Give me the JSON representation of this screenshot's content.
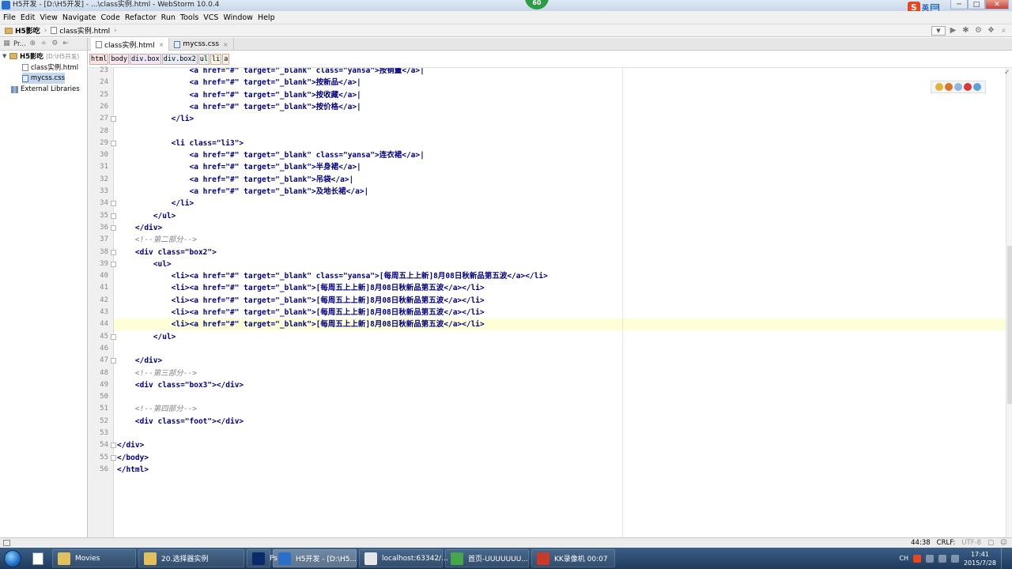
{
  "window": {
    "title": "H5开发 - [D:\\H5开发] - ...\\class实例.html - WebStorm 10.0.4",
    "badge": "60",
    "ime_lang": "英",
    "controls": {
      "minimize": "─",
      "maximize": "□",
      "close": "✕"
    }
  },
  "menu": [
    "File",
    "Edit",
    "View",
    "Navigate",
    "Code",
    "Refactor",
    "Run",
    "Tools",
    "VCS",
    "Window",
    "Help"
  ],
  "navbar": {
    "project": "H5影吃",
    "file": "class实例.html",
    "sep": "›"
  },
  "project_panel": {
    "toolbar_label": "Pr...",
    "root": {
      "name": "H5影吃",
      "path": "(D:\\H5开发)"
    },
    "files": [
      "class实例.html",
      "mycss.css"
    ],
    "external": "External Libraries"
  },
  "tabs": [
    {
      "label": "class实例.html",
      "active": true
    },
    {
      "label": "mycss.css",
      "active": false
    }
  ],
  "tag_breadcrumb": [
    "html",
    "body",
    "div.box",
    "div.box2",
    "ul",
    "li",
    "a"
  ],
  "code": {
    "lines": [
      {
        "n": "23",
        "text": "                <a href=\"#\" target=\"_blank\" class=\"yansa\">按销量</a>|",
        "kind": "tag"
      },
      {
        "n": "24",
        "text": "                <a href=\"#\" target=\"_blank\">按新品</a>|",
        "kind": "tag"
      },
      {
        "n": "25",
        "text": "                <a href=\"#\" target=\"_blank\">按收藏</a>|",
        "kind": "tag"
      },
      {
        "n": "26",
        "text": "                <a href=\"#\" target=\"_blank\">按价格</a>|",
        "kind": "tag"
      },
      {
        "n": "27",
        "text": "            </li>",
        "kind": "tag"
      },
      {
        "n": "28",
        "text": "",
        "kind": "tag"
      },
      {
        "n": "29",
        "text": "            <li class=\"li3\">",
        "kind": "tag"
      },
      {
        "n": "30",
        "text": "                <a href=\"#\" target=\"_blank\" class=\"yansa\">连衣裙</a>|",
        "kind": "tag"
      },
      {
        "n": "31",
        "text": "                <a href=\"#\" target=\"_blank\">半身裙</a>|",
        "kind": "tag"
      },
      {
        "n": "32",
        "text": "                <a href=\"#\" target=\"_blank\">吊袋</a>|",
        "kind": "tag"
      },
      {
        "n": "33",
        "text": "                <a href=\"#\" target=\"_blank\">及地长裙</a>|",
        "kind": "tag"
      },
      {
        "n": "34",
        "text": "            </li>",
        "kind": "tag"
      },
      {
        "n": "35",
        "text": "        </ul>",
        "kind": "tag"
      },
      {
        "n": "36",
        "text": "    </div>",
        "kind": "tag"
      },
      {
        "n": "37",
        "text": "    <!--第二部分-->",
        "kind": "comment"
      },
      {
        "n": "38",
        "text": "    <div class=\"box2\">",
        "kind": "tag"
      },
      {
        "n": "39",
        "text": "        <ul>",
        "kind": "tag"
      },
      {
        "n": "40",
        "text": "            <li><a href=\"#\" target=\"_blank\" class=\"yansa\">[每周五上上新]8月08日秋新品第五波</a></li>",
        "kind": "tag"
      },
      {
        "n": "41",
        "text": "            <li><a href=\"#\" target=\"_blank\">[每周五上上新]8月08日秋新品第五波</a></li>",
        "kind": "tag"
      },
      {
        "n": "42",
        "text": "            <li><a href=\"#\" target=\"_blank\">[每周五上上新]8月08日秋新品第五波</a></li>",
        "kind": "tag"
      },
      {
        "n": "43",
        "text": "            <li><a href=\"#\" target=\"_blank\">[每周五上上新]8月08日秋新品第五波</a></li>",
        "kind": "tag"
      },
      {
        "n": "44",
        "text": "            <li><a href=\"#\" target=\"_blank\">[每周五上上新]8月08日秋新品第五波</a></li>",
        "kind": "tag"
      },
      {
        "n": "45",
        "text": "        </ul>",
        "kind": "tag"
      },
      {
        "n": "46",
        "text": "",
        "kind": "tag"
      },
      {
        "n": "47",
        "text": "    </div>",
        "kind": "tag"
      },
      {
        "n": "48",
        "text": "    <!--第三部分-->",
        "kind": "comment"
      },
      {
        "n": "49",
        "text": "    <div class=\"box3\"></div>",
        "kind": "tag"
      },
      {
        "n": "50",
        "text": "",
        "kind": "tag"
      },
      {
        "n": "51",
        "text": "    <!--第四部分-->",
        "kind": "comment"
      },
      {
        "n": "52",
        "text": "    <div class=\"foot\"></div>",
        "kind": "tag"
      },
      {
        "n": "53",
        "text": "",
        "kind": "tag"
      },
      {
        "n": "54",
        "text": "</div>",
        "kind": "tag"
      },
      {
        "n": "55",
        "text": "</body>",
        "kind": "tag"
      },
      {
        "n": "56",
        "text": "</html>",
        "kind": "tag"
      }
    ],
    "caret_line": "44"
  },
  "status": {
    "position": "44:38",
    "line_sep": "CRLF:",
    "encoding": "UTF-8"
  },
  "taskbar": {
    "items": [
      {
        "label": "Movies",
        "icon_color": "#e2c15d"
      },
      {
        "label": "20.选择器实例",
        "icon_color": "#e2c15d"
      },
      {
        "label": "Ps",
        "icon_color": "#0b2a6b"
      },
      {
        "label": "H5开发 - [D:\\H5...",
        "icon_color": "#2a6fc9",
        "active": true
      },
      {
        "label": "localhost:63342/...",
        "icon_color": "#e6e6e6"
      },
      {
        "label": "首页-UUUUUUU...",
        "icon_color": "#44a84a"
      },
      {
        "label": "KK录像机 00:07",
        "icon_color": "#c93a2a"
      }
    ],
    "tray": {
      "lang": "CH",
      "time": "17:41",
      "date": "2015/7/28"
    }
  },
  "colors": {
    "tag": "#000080",
    "comment": "#808080",
    "caret_line": "#ffffd7"
  }
}
